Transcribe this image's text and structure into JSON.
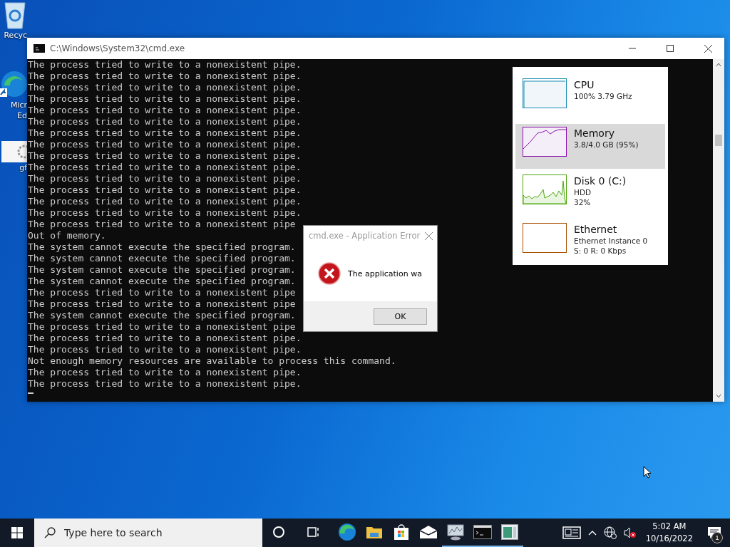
{
  "desktop_icons": [
    {
      "kind": "recycle-bin",
      "label_lines": [
        "Recyc"
      ]
    },
    {
      "kind": "edge",
      "label_lines": [
        "Micr",
        "Ed"
      ]
    },
    {
      "kind": "settings-file",
      "label_lines": [
        "gf"
      ]
    }
  ],
  "console_window": {
    "title": "C:\\Windows\\System32\\cmd.exe",
    "lines": [
      "The process tried to write to a nonexistent pipe.",
      "The process tried to write to a nonexistent pipe.",
      "The process tried to write to a nonexistent pipe.",
      "The process tried to write to a nonexistent pipe.",
      "The process tried to write to a nonexistent pipe.",
      "The process tried to write to a nonexistent pipe.",
      "The process tried to write to a nonexistent pipe.",
      "The process tried to write to a nonexistent pipe.",
      "The process tried to write to a nonexistent pipe.",
      "The process tried to write to a nonexistent pipe.",
      "The process tried to write to a nonexistent pipe.",
      "The process tried to write to a nonexistent pipe.",
      "The process tried to write to a nonexistent pipe.",
      "The process tried to write to a nonexistent pipe.",
      "The process tried to write to a nonexistent pipe",
      "Out of memory.",
      "The system cannot execute the specified program.",
      "The system cannot execute the specified program.",
      "The system cannot execute the specified program.",
      "The system cannot execute the specified program.",
      "The process tried to write to a nonexistent pipe",
      "The process tried to write to a nonexistent pipe",
      "The system cannot execute the specified program.",
      "The process tried to write to a nonexistent pipe",
      "The process tried to write to a nonexistent pipe.",
      "The process tried to write to a nonexistent pipe.",
      "Not enough memory resources are available to process this command.",
      "The process tried to write to a nonexistent pipe.",
      "The process tried to write to a nonexistent pipe."
    ]
  },
  "performance_panel": {
    "items": [
      {
        "kind": "cpu",
        "name": "CPU",
        "details": [
          "100%  3.79 GHz"
        ],
        "color": "#1a8bb4",
        "selected": false
      },
      {
        "kind": "memory",
        "name": "Memory",
        "details": [
          "3.8/4.0 GB (95%)"
        ],
        "color": "#8b12ae",
        "selected": true
      },
      {
        "kind": "disk",
        "name": "Disk 0 (C:)",
        "details": [
          "HDD",
          "32%"
        ],
        "color": "#4da60c",
        "selected": false
      },
      {
        "kind": "ethernet",
        "name": "Ethernet",
        "details": [
          "Ethernet Instance 0",
          "S: 0 R: 0 Kbps"
        ],
        "color": "#a74f01",
        "selected": false
      }
    ]
  },
  "error_dialog": {
    "title": "cmd.exe - Application Error",
    "active": false,
    "message": "The application wa",
    "buttons": [
      "OK"
    ]
  },
  "taskbar": {
    "search": {
      "placeholder": "Type here to search"
    },
    "apps": [
      {
        "kind": "cortana",
        "running": false
      },
      {
        "kind": "task-view",
        "running": false
      },
      {
        "kind": "edge",
        "running": false
      },
      {
        "kind": "explorer",
        "running": false
      },
      {
        "kind": "store",
        "running": false
      },
      {
        "kind": "mail",
        "running": false
      },
      {
        "kind": "perfmon",
        "running": true
      },
      {
        "kind": "cmd",
        "running": true
      },
      {
        "kind": "app-window",
        "running": true
      }
    ],
    "volume_muted": true,
    "clock": {
      "time": "5:02 AM",
      "date": "10/16/2022"
    },
    "notifications": {
      "count": "1"
    }
  }
}
